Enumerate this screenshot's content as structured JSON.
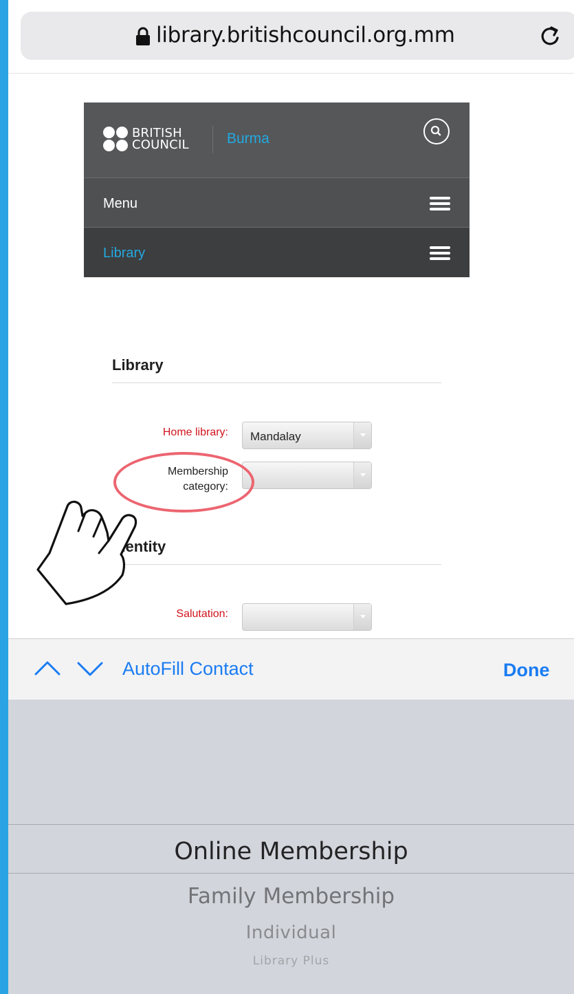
{
  "browser": {
    "url": "library.britishcouncil.org.mm"
  },
  "site": {
    "logo_line1": "BRITISH",
    "logo_line2": "COUNCIL",
    "country": "Burma",
    "menu_label": "Menu",
    "library_label": "Library"
  },
  "form": {
    "library_section": {
      "title": "Library",
      "home_library_label": "Home library:",
      "home_library_value": "Mandalay",
      "membership_label_line1": "Membership",
      "membership_label_line2": "category:",
      "membership_value": ""
    },
    "identity_section": {
      "title": "Identity",
      "salutation_label": "Salutation:",
      "salutation_value": ""
    }
  },
  "keyboard_bar": {
    "autofill_label": "AutoFill Contact",
    "done_label": "Done"
  },
  "picker": {
    "options": [
      "Online Membership",
      "Family Membership",
      "Individual",
      "Library Plus"
    ],
    "selected": "Online Membership"
  },
  "colors": {
    "frame": "#29a3e3",
    "brand_accent": "#23a9e1",
    "required_label": "#d0141c",
    "highlight_ring": "#ec6570",
    "ios_blue": "#1a7cf2"
  }
}
